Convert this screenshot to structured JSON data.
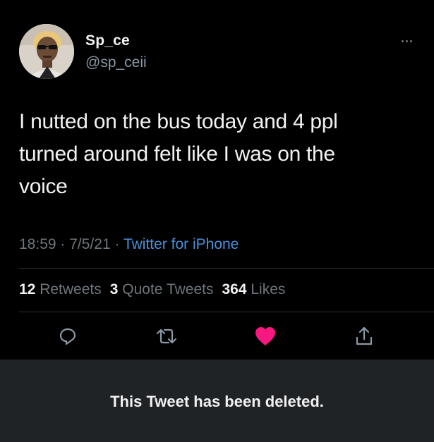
{
  "user": {
    "display_name": "Sp_ce",
    "handle": "@sp_ceii"
  },
  "tweet": {
    "text_lines": [
      "I nutted on the bus today and 4 ppl",
      "turned around felt like I was on the",
      "voice"
    ],
    "time": "18:59",
    "date": "7/5/21",
    "separator": "·",
    "source": "Twitter for iPhone"
  },
  "stats": {
    "retweets_count": "12",
    "retweets_label": "Retweets",
    "quotes_count": "3",
    "quotes_label": "Quote Tweets",
    "likes_count": "364",
    "likes_label": "Likes"
  },
  "actions": {
    "reply_icon": "reply-icon",
    "retweet_icon": "retweet-icon",
    "like_icon": "heart-icon",
    "share_icon": "share-icon",
    "liked": true
  },
  "banner": {
    "text": "This Tweet has been deleted."
  },
  "colors": {
    "background": "#000000",
    "text": "#f2f2f2",
    "muted": "#6e767d",
    "link": "#4a90d9",
    "like": "#f91880",
    "banner_bg": "#1f2326"
  }
}
